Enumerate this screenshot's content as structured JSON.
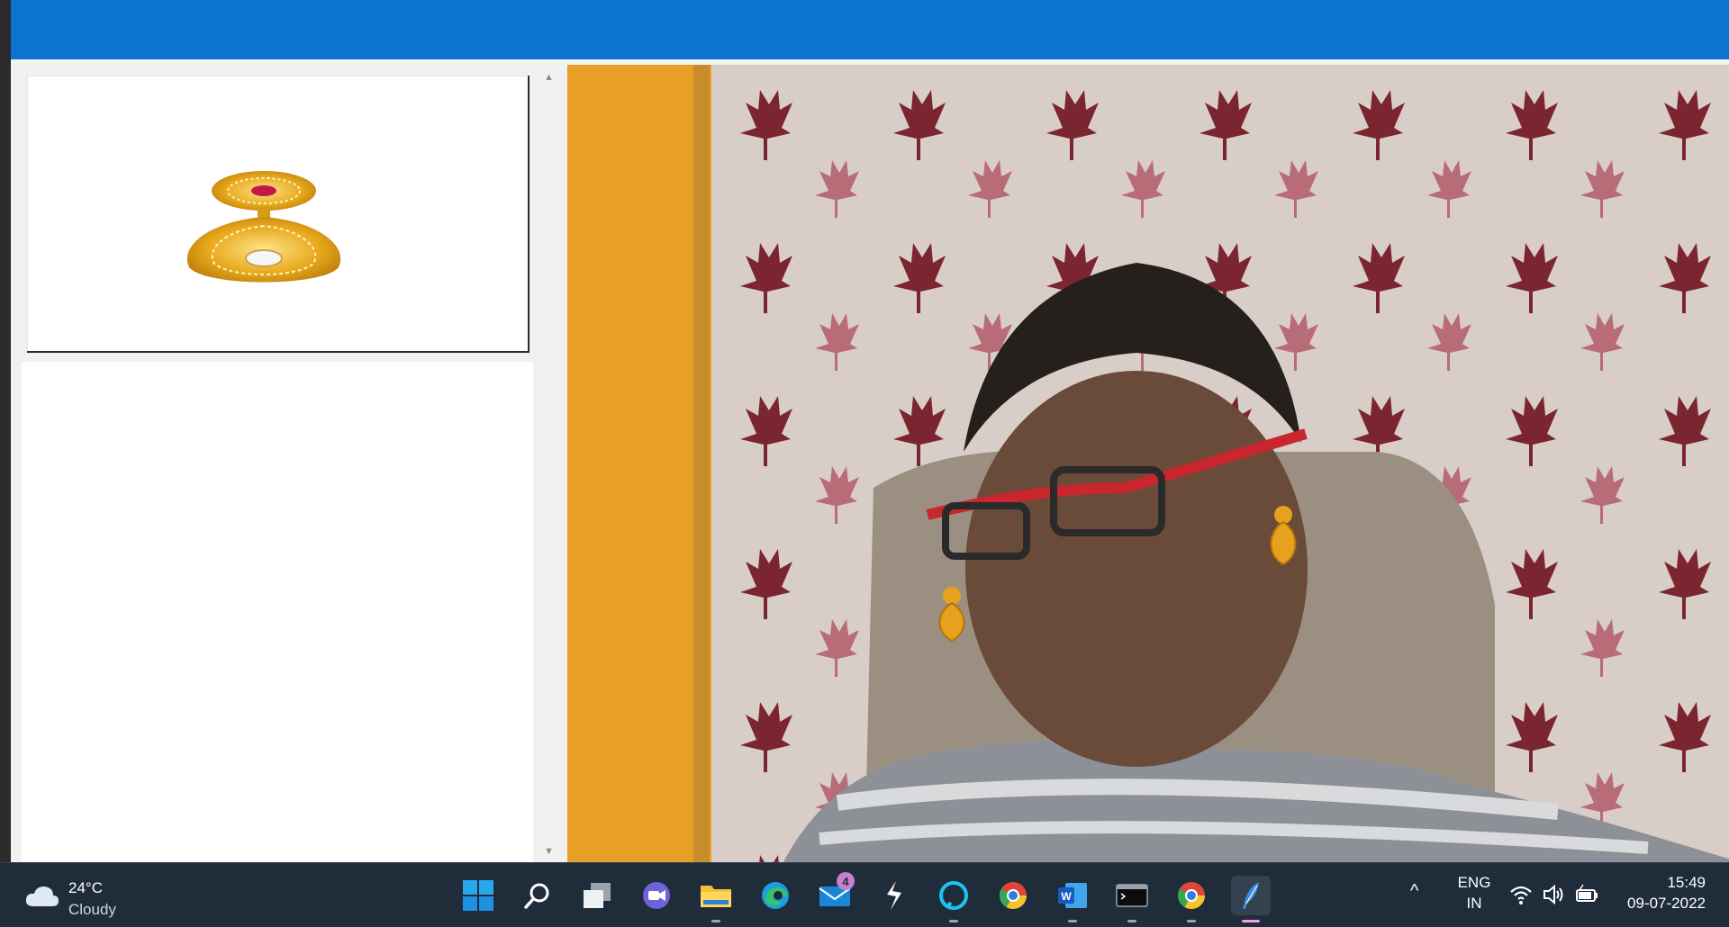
{
  "window": {
    "titlebar_color": "#0a74d0"
  },
  "preview": {
    "item_image": "gold-drop-earring",
    "accent": "#e0a11a"
  },
  "camera": {
    "overlay": "earring-overlays-on-webcam-feed"
  },
  "taskbar": {
    "weather": {
      "temperature": "24°C",
      "condition": "Cloudy",
      "icon": "cloud-icon"
    },
    "apps": [
      {
        "name": "start-button",
        "icon": "windows-logo-icon",
        "running": false
      },
      {
        "name": "search-button",
        "icon": "search-icon",
        "running": false
      },
      {
        "name": "task-view-button",
        "icon": "task-view-icon",
        "running": false
      },
      {
        "name": "teams-chat-button",
        "icon": "chat-icon",
        "running": false
      },
      {
        "name": "file-explorer-button",
        "icon": "folder-icon",
        "running": true
      },
      {
        "name": "edge-button",
        "icon": "edge-icon",
        "running": false
      },
      {
        "name": "mail-button",
        "icon": "mail-icon",
        "running": false,
        "badge": "4"
      },
      {
        "name": "app-button-zigzag",
        "icon": "zigzag-icon",
        "running": false
      },
      {
        "name": "alexa-button",
        "icon": "alexa-icon",
        "running": true
      },
      {
        "name": "chrome-button-1",
        "icon": "chrome-icon",
        "running": false
      },
      {
        "name": "word-button",
        "icon": "word-icon",
        "running": true
      },
      {
        "name": "terminal-button",
        "icon": "terminal-icon",
        "running": true
      },
      {
        "name": "chrome-button-2",
        "icon": "chrome-icon",
        "running": true
      },
      {
        "name": "python-app-button",
        "icon": "feather-icon",
        "running": true,
        "focused": true
      }
    ],
    "tray": {
      "chevron": "^",
      "lang_line1": "ENG",
      "lang_line2": "IN",
      "icons": [
        "wifi-icon",
        "volume-icon",
        "battery-icon"
      ]
    },
    "clock": {
      "time": "15:49",
      "date": "09-07-2022"
    }
  }
}
